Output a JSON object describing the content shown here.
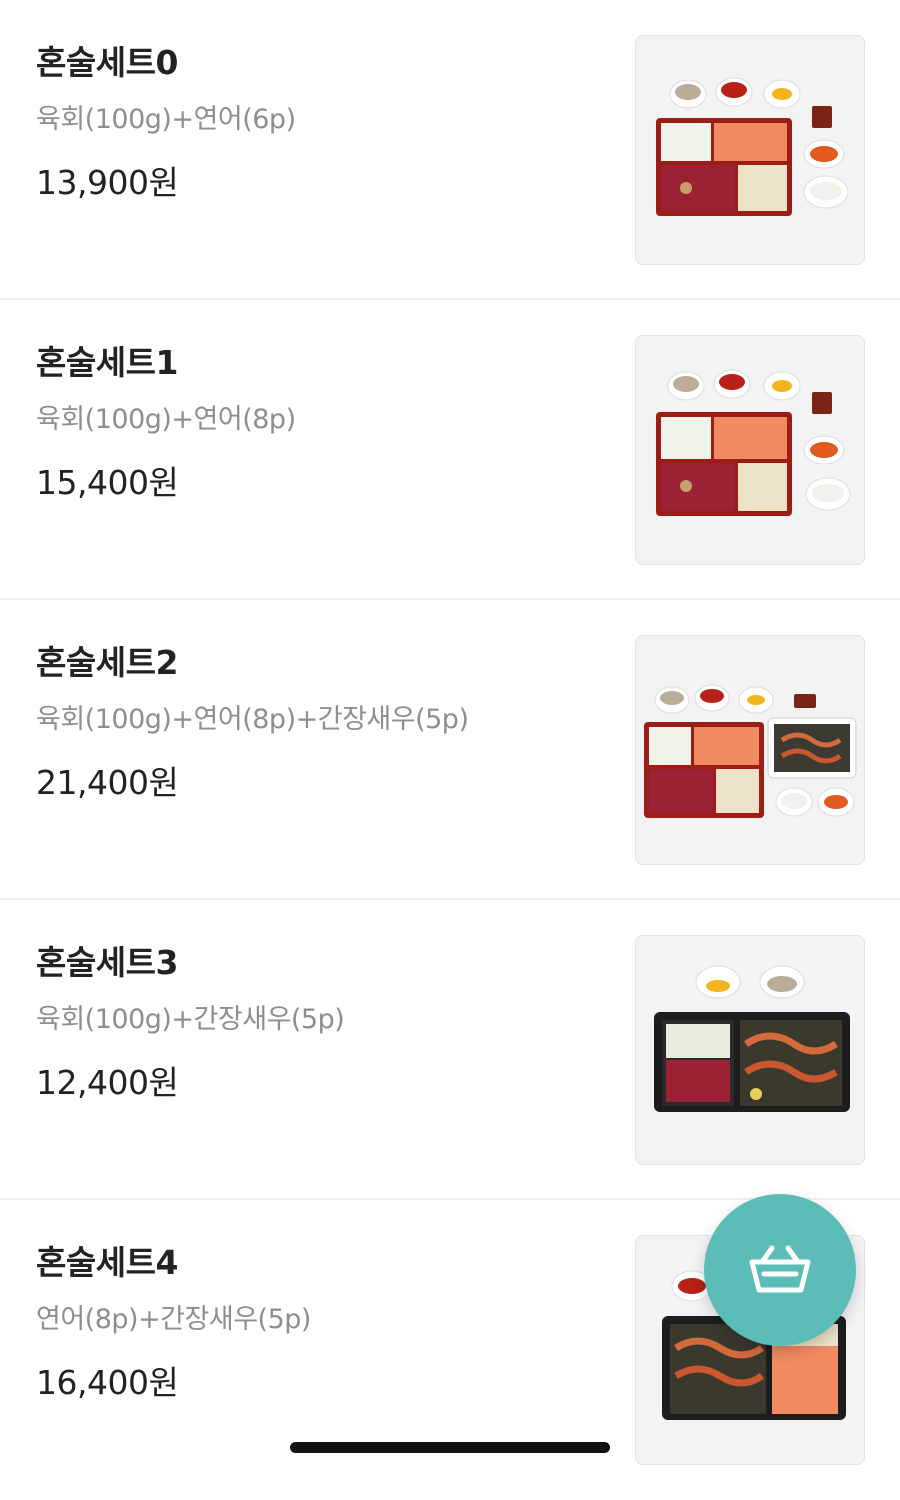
{
  "menu": {
    "items": [
      {
        "name": "혼술세트0",
        "desc": "육회(100g)+연어(6p)",
        "price": "13,900원",
        "image": "red-box-set-photo"
      },
      {
        "name": "혼술세트1",
        "desc": "육회(100g)+연어(8p)",
        "price": "15,400원",
        "image": "red-box-set-photo"
      },
      {
        "name": "혼술세트2",
        "desc": "육회(100g)+연어(8p)+간장새우(5p)",
        "price": "21,400원",
        "image": "red-box-shrimp-set-photo"
      },
      {
        "name": "혼술세트3",
        "desc": "육회(100g)+간장새우(5p)",
        "price": "12,400원",
        "image": "black-box-shrimp-set-photo"
      },
      {
        "name": "혼술세트4",
        "desc": "연어(8p)+간장새우(5p)",
        "price": "16,400원",
        "image": "black-box-salmon-shrimp-photo"
      }
    ]
  },
  "cart_button": {
    "icon": "shopping-basket-icon",
    "color": "#5bbcb8"
  },
  "colors": {
    "title_text": "#222222",
    "desc_text": "#8e8e8e",
    "divider": "#efefef"
  }
}
